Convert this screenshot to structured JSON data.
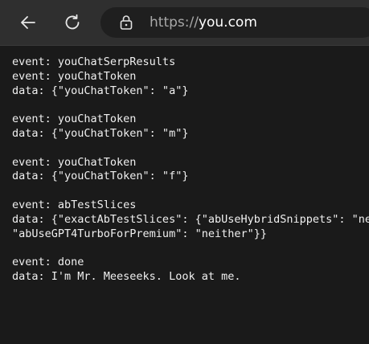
{
  "browser": {
    "url_scheme": "https://",
    "url_host": "you.com"
  },
  "icons": {
    "back": "back-arrow-icon",
    "reload": "reload-icon",
    "lock": "lock-icon"
  },
  "stream_lines": [
    "event: youChatSerpResults",
    "event: youChatToken",
    "data: {\"youChatToken\": \"a\"}",
    "",
    "event: youChatToken",
    "data: {\"youChatToken\": \"m\"}",
    "",
    "event: youChatToken",
    "data: {\"youChatToken\": \"f\"}",
    "",
    "event: abTestSlices",
    "data: {\"exactAbTestSlices\": {\"abUseHybridSnippets\": \"neither\",",
    "\"abUseGPT4TurboForPremium\": \"neither\"}}",
    "",
    "event: done",
    "data: I'm Mr. Meeseeks. Look at me."
  ]
}
